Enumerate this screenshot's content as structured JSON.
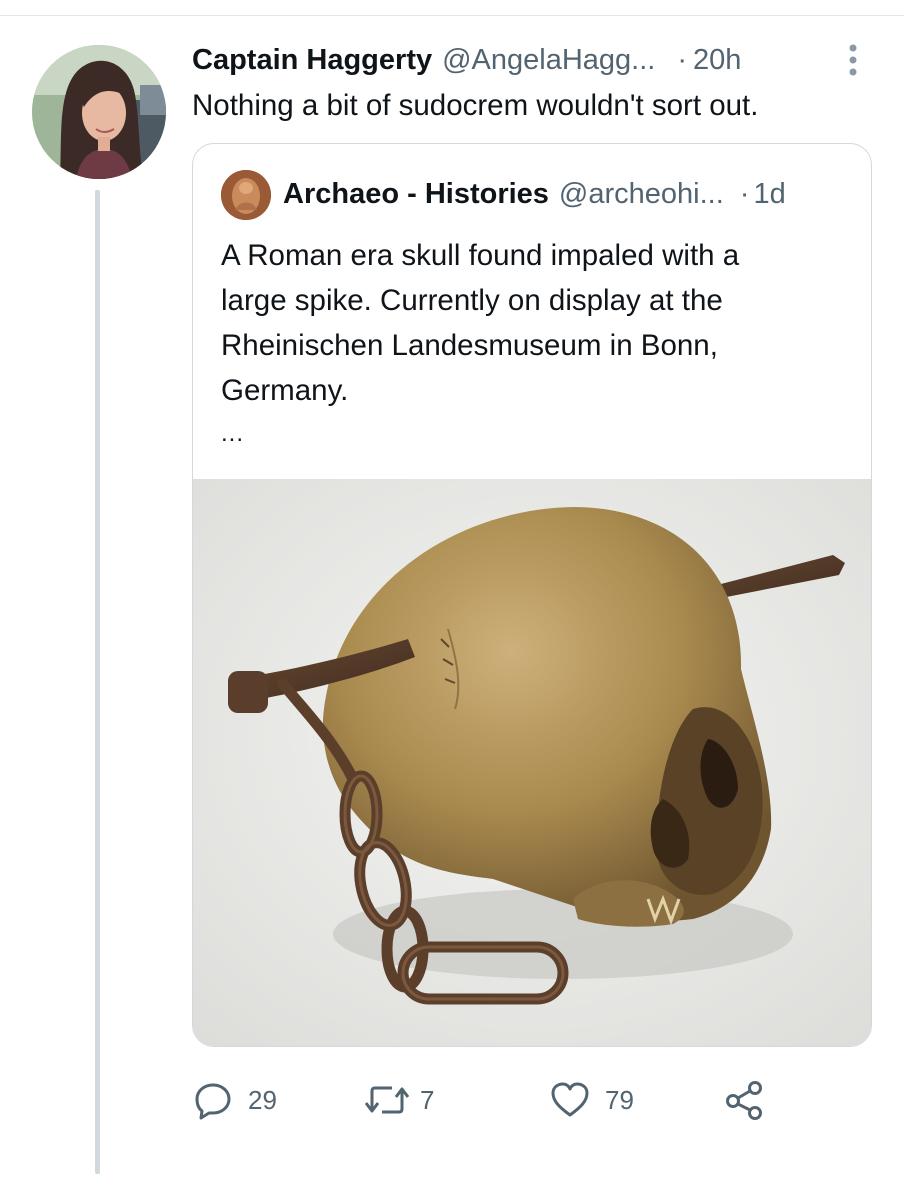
{
  "reply_tweet": {
    "display_name": "Captain Haggerty",
    "handle": "@AngelaHagg...",
    "separator": "·",
    "time": "20h",
    "text": "Nothing a bit of sudocrem wouldn't sort out."
  },
  "quoted_tweet": {
    "display_name": "Archaeo - Histories",
    "handle": "@archeohi...",
    "separator": "·",
    "time": "1d",
    "text_lines": [
      "A Roman era skull found impaled with a",
      "large spike. Currently on display at the",
      "Rheinischen Landesmuseum in Bonn,",
      "Germany."
    ],
    "truncation": "..."
  },
  "actions": {
    "reply": {
      "icon": "reply-icon",
      "count": "29"
    },
    "retweet": {
      "icon": "retweet-icon",
      "count": "7"
    },
    "like": {
      "icon": "heart-icon",
      "count": "79"
    },
    "share": {
      "icon": "share-icon"
    }
  },
  "colors": {
    "text_primary": "#0f1419",
    "text_secondary": "#536471",
    "border": "#cfd9de"
  }
}
